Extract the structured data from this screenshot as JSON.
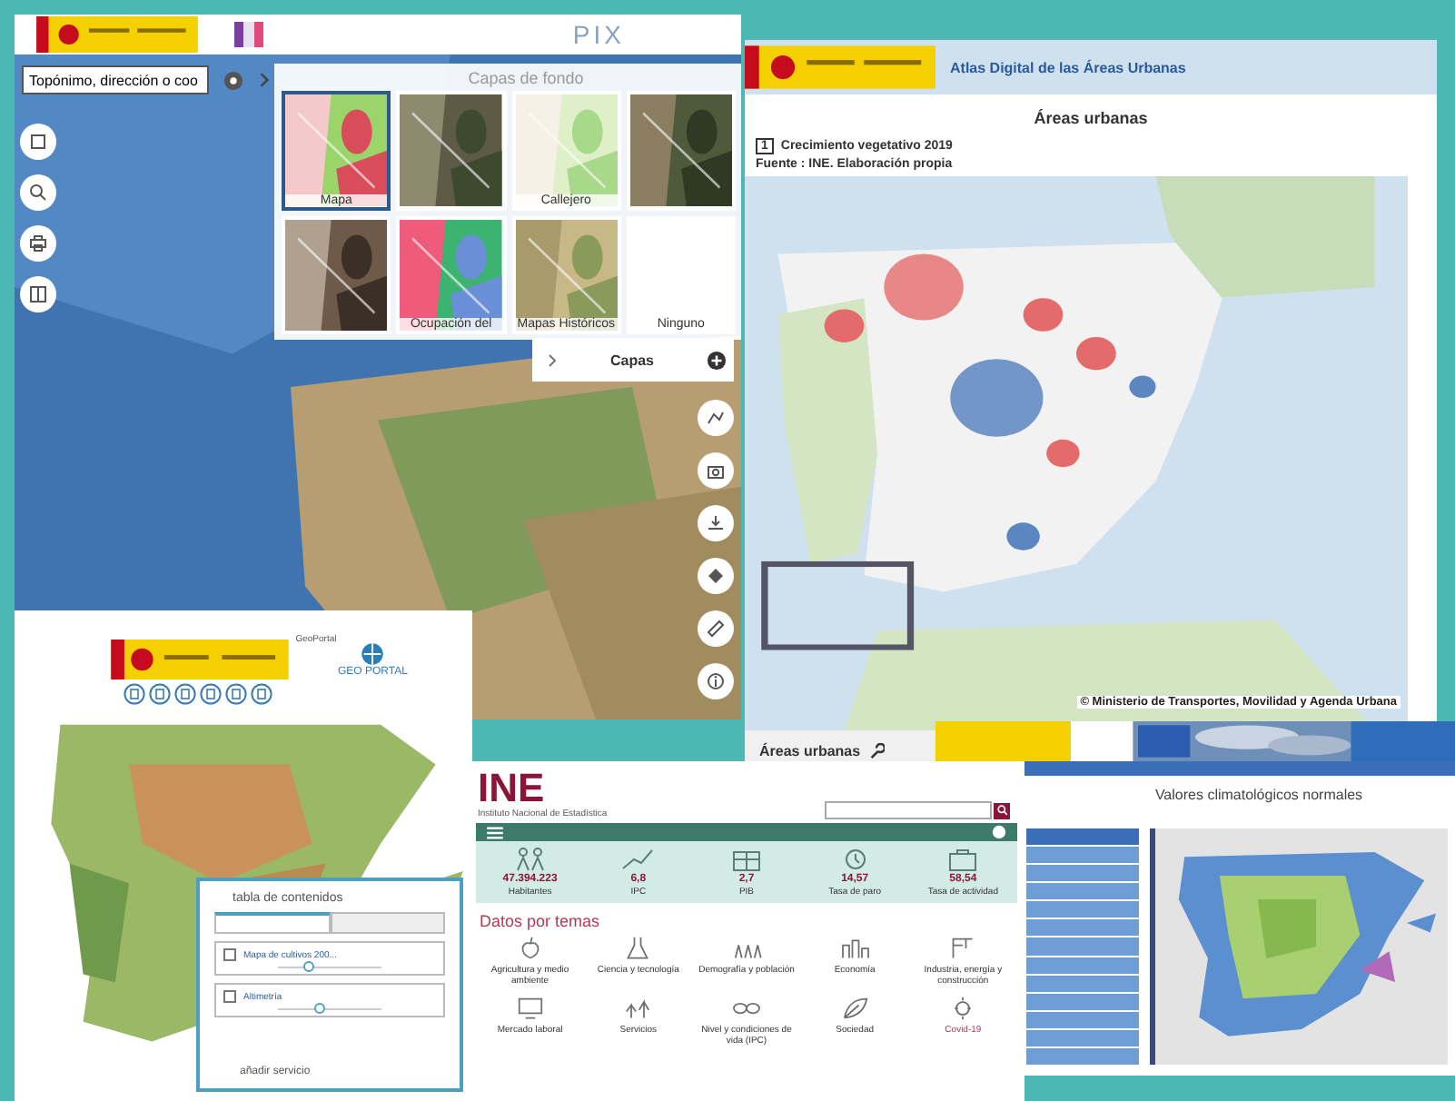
{
  "visor": {
    "brand": "PIX",
    "search": {
      "value": "Topónimo, dirección o coo"
    },
    "basemaps": {
      "title": "Capas de fondo",
      "tiles": [
        {
          "label": "Mapa",
          "kind": "picture",
          "selected": true
        },
        {
          "kind": "picture",
          "selected": false
        },
        {
          "label": "Callejero",
          "kind": "picture",
          "selected": false
        },
        {
          "kind": "picture",
          "selected": false
        },
        {
          "kind": "picture",
          "selected": false
        },
        {
          "label": "Ocupación del",
          "kind": "picture",
          "selected": false
        },
        {
          "label": "Mapas Históricos",
          "kind": "picture",
          "selected": false
        },
        {
          "label": "Ninguno",
          "kind": "none",
          "selected": false
        }
      ]
    },
    "layers_panel": {
      "title": "Capas"
    }
  },
  "atlas": {
    "title": "Atlas Digital de las Áreas Urbanas",
    "heading": "Áreas urbanas",
    "map_number": "1",
    "map_title": "Crecimiento vegetativo 2019",
    "source": "Fuente : INE. Elaboración propia",
    "copyright": "© Ministerio de Transportes, Movilidad y Agenda Urbana",
    "footer_title": "Áreas urbanas"
  },
  "geoportal": {
    "page_title": "GeoPortal",
    "logo": "GEO PORTAL",
    "toc": {
      "title": "tabla de contenidos",
      "tabs": [
        {
          "selected": true
        },
        {
          "selected": false
        }
      ],
      "layers": [
        {
          "name": "Mapa de cultivos 200...",
          "checked": false,
          "level": 0.3
        },
        {
          "name": "Altimetría",
          "checked": false,
          "level": 0.4
        }
      ],
      "add": "añadir servicio"
    }
  },
  "ine": {
    "logo": "INE",
    "subtitle": "Instituto Nacional de Estadística",
    "stats": [
      {
        "value": "47.394.223",
        "label": "Habitantes"
      },
      {
        "value": "6,8",
        "label": "IPC"
      },
      {
        "value": "2,7",
        "label": "PIB"
      },
      {
        "value": "14,57",
        "label": "Tasa de paro"
      },
      {
        "value": "58,54",
        "label": "Tasa de actividad"
      }
    ],
    "section": "Datos por temas",
    "topics": [
      {
        "label": "Agricultura y medio ambiente"
      },
      {
        "label": "Ciencia y tecnología"
      },
      {
        "label": "Demografía y población"
      },
      {
        "label": "Economía"
      },
      {
        "label": "Industria, energía y construcción"
      },
      {
        "label": "Mercado laboral"
      },
      {
        "label": "Servicios"
      },
      {
        "label": "Nivel y condiciones de vida (IPC)"
      },
      {
        "label": "Sociedad"
      },
      {
        "label": "Covid-19"
      }
    ]
  },
  "aemet": {
    "title": "Valores climatológicos normales",
    "menu": [
      {
        "selected": true
      },
      {
        "selected": false
      },
      {
        "selected": false
      },
      {
        "selected": false
      },
      {
        "selected": false
      },
      {
        "selected": false
      },
      {
        "selected": false
      },
      {
        "selected": false
      },
      {
        "selected": false
      },
      {
        "selected": false
      },
      {
        "selected": false
      },
      {
        "selected": false
      },
      {
        "selected": false
      }
    ]
  }
}
